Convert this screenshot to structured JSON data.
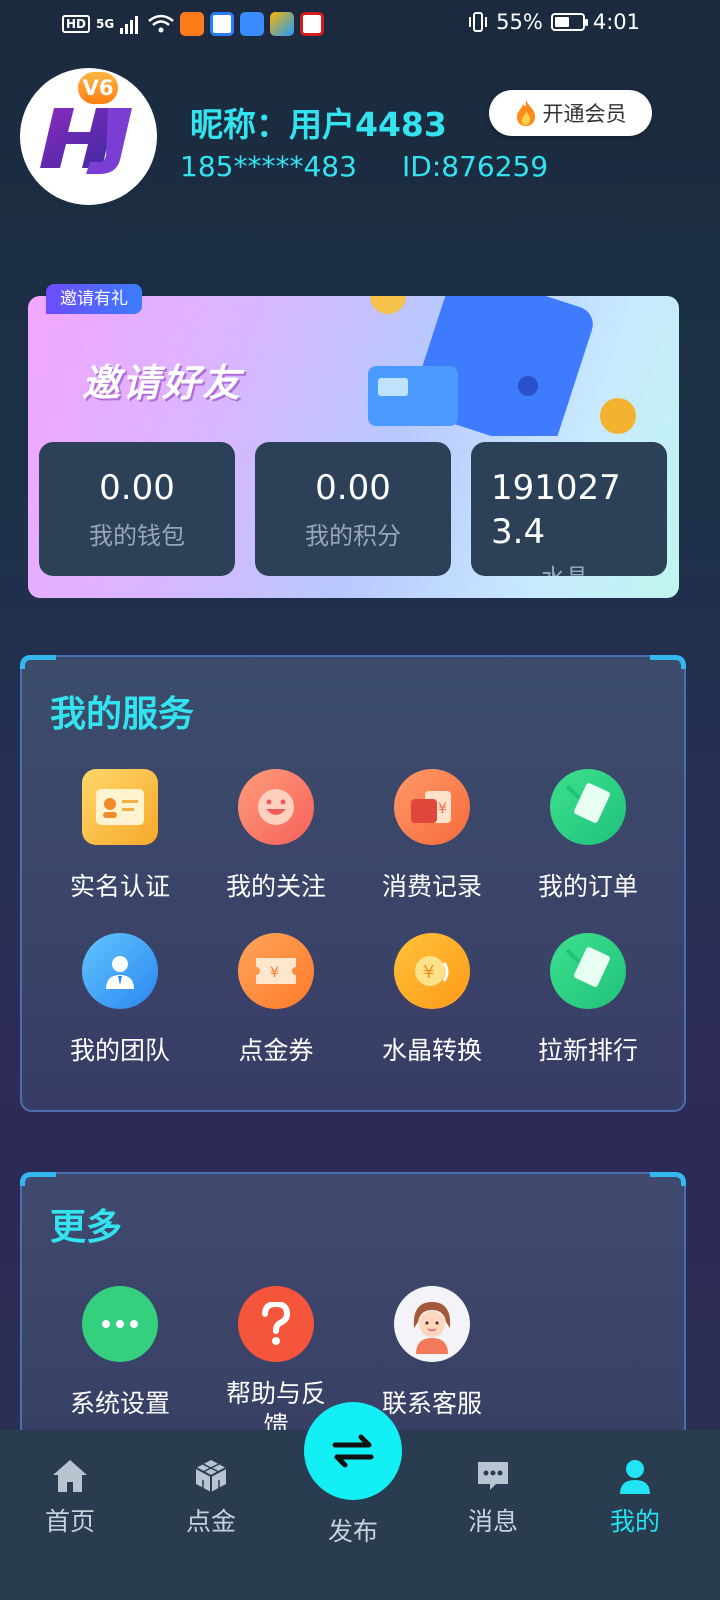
{
  "status_bar": {
    "battery": "55%",
    "time": "4:01",
    "hd": "HD",
    "network": "5G"
  },
  "profile": {
    "level": "V6",
    "nickname": "昵称：用户4483",
    "phone": "185*****483",
    "user_id": "ID:876259",
    "vip_button": "开通会员"
  },
  "invite": {
    "tag": "邀请有礼",
    "title": "邀请好友",
    "stats": [
      {
        "value": "0.00",
        "label": "我的钱包"
      },
      {
        "value": "0.00",
        "label": "我的积分"
      },
      {
        "value": "1910273.4",
        "label": "水晶"
      }
    ]
  },
  "services": {
    "title": "我的服务",
    "items": [
      {
        "label": "实名认证",
        "icon": "id-card-icon"
      },
      {
        "label": "我的关注",
        "icon": "smile-icon"
      },
      {
        "label": "消费记录",
        "icon": "wallet-icon"
      },
      {
        "label": "我的订单",
        "icon": "order-icon"
      },
      {
        "label": "我的团队",
        "icon": "team-icon"
      },
      {
        "label": "点金券",
        "icon": "coupon-icon"
      },
      {
        "label": "水晶转换",
        "icon": "exchange-icon"
      },
      {
        "label": "拉新排行",
        "icon": "ranking-icon"
      }
    ]
  },
  "more": {
    "title": "更多",
    "items": [
      {
        "label": "系统设置",
        "icon": "more-dots-icon"
      },
      {
        "label": "帮助与反馈",
        "icon": "question-icon"
      },
      {
        "label": "联系客服",
        "icon": "support-agent-icon"
      }
    ]
  },
  "bottom_nav": {
    "items": [
      {
        "label": "首页",
        "icon": "home-icon"
      },
      {
        "label": "点金",
        "icon": "cube-icon"
      },
      {
        "label": "发布",
        "icon": "swap-icon"
      },
      {
        "label": "消息",
        "icon": "message-icon"
      },
      {
        "label": "我的",
        "icon": "person-icon",
        "active": true
      }
    ]
  },
  "colors": {
    "accent": "#33e4f0",
    "publish": "#12f0f5",
    "nav_bg": "#2a3c50"
  }
}
